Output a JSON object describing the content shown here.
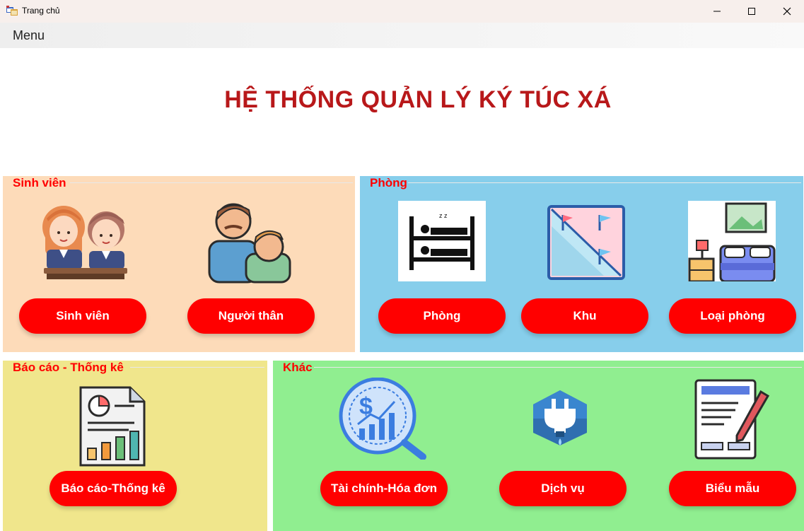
{
  "window": {
    "title": "Trang chủ",
    "minimize_glyph": "—",
    "maximize_glyph": "☐",
    "close_glyph": "✕"
  },
  "menu": {
    "label": "Menu"
  },
  "main_title": "HỆ THỐNG QUẢN LÝ KÝ TÚC XÁ",
  "groups": {
    "sinh_vien": {
      "label": "Sinh viên",
      "buttons": [
        "Sinh viên",
        "Người thân"
      ],
      "icons": [
        "students-icon",
        "parent-child-icon"
      ],
      "color": "#fddbb9"
    },
    "phong": {
      "label": "Phòng",
      "buttons": [
        "Phòng",
        "Khu",
        "Loại phòng"
      ],
      "icons": [
        "bunk-bed-icon",
        "map-flags-icon",
        "bedroom-icon"
      ],
      "color": "#87ceeb"
    },
    "bao_cao": {
      "label": "Báo cáo - Thống kê",
      "buttons": [
        "Báo cáo-Thống kê"
      ],
      "icons": [
        "report-chart-icon"
      ],
      "color": "#f0e68c"
    },
    "khac": {
      "label": "Khác",
      "buttons": [
        "Tài chính-Hóa đơn",
        "Dịch vụ",
        "Biểu mẫu"
      ],
      "icons": [
        "finance-magnifier-icon",
        "utility-service-icon",
        "form-document-icon"
      ],
      "color": "#90ee90"
    }
  },
  "colors": {
    "accent": "#ff0000",
    "title": "#b8181a"
  }
}
